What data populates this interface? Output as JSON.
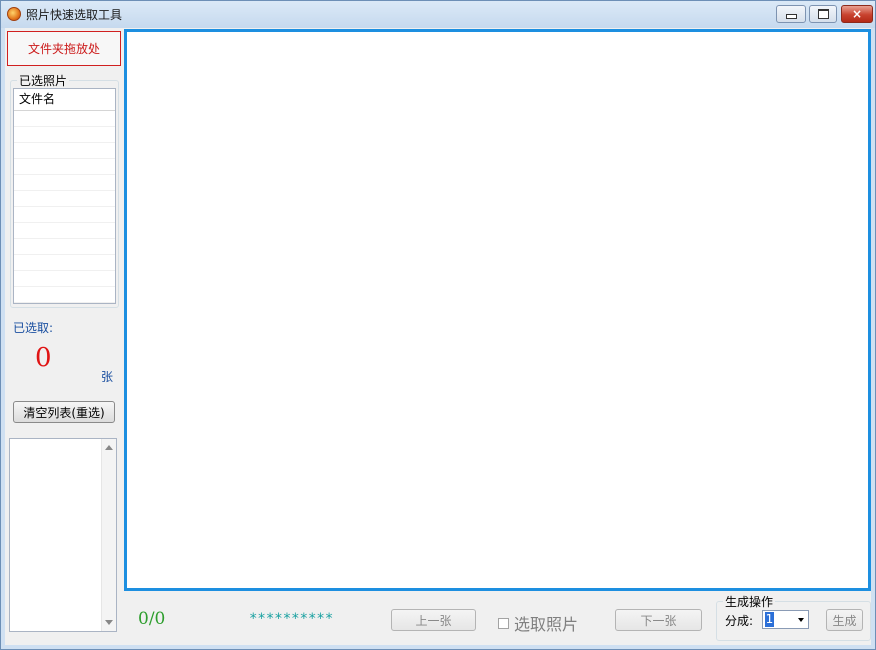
{
  "window": {
    "title": "照片快速选取工具",
    "controls": {
      "minimize": "minimize",
      "maximize": "maximize",
      "close": "×"
    }
  },
  "sidebar": {
    "drop_zone_label": "文件夹拖放处",
    "selected_group_title": "已选照片",
    "list_column_header": "文件名",
    "list_rows": [],
    "selected_label": "已选取:",
    "selected_count": "0",
    "selected_unit": "张",
    "clear_button_label": "清空列表(重选)",
    "log_text": ""
  },
  "bottom_bar": {
    "progress": "0/0",
    "current_filename": "**********",
    "prev_button_label": "上一张",
    "select_checkbox_label": "选取照片",
    "select_checked": false,
    "next_button_label": "下一张",
    "generate_group_title": "生成操作",
    "split_label": "分成:",
    "split_value": "1",
    "generate_button_label": "生成"
  },
  "colors": {
    "viewer_border": "#1d8fe0",
    "drop_zone_text": "#cc1b1b",
    "count_text": "#e01414",
    "progress_text": "#2e9e2e",
    "filename_text": "#18a0a0"
  }
}
